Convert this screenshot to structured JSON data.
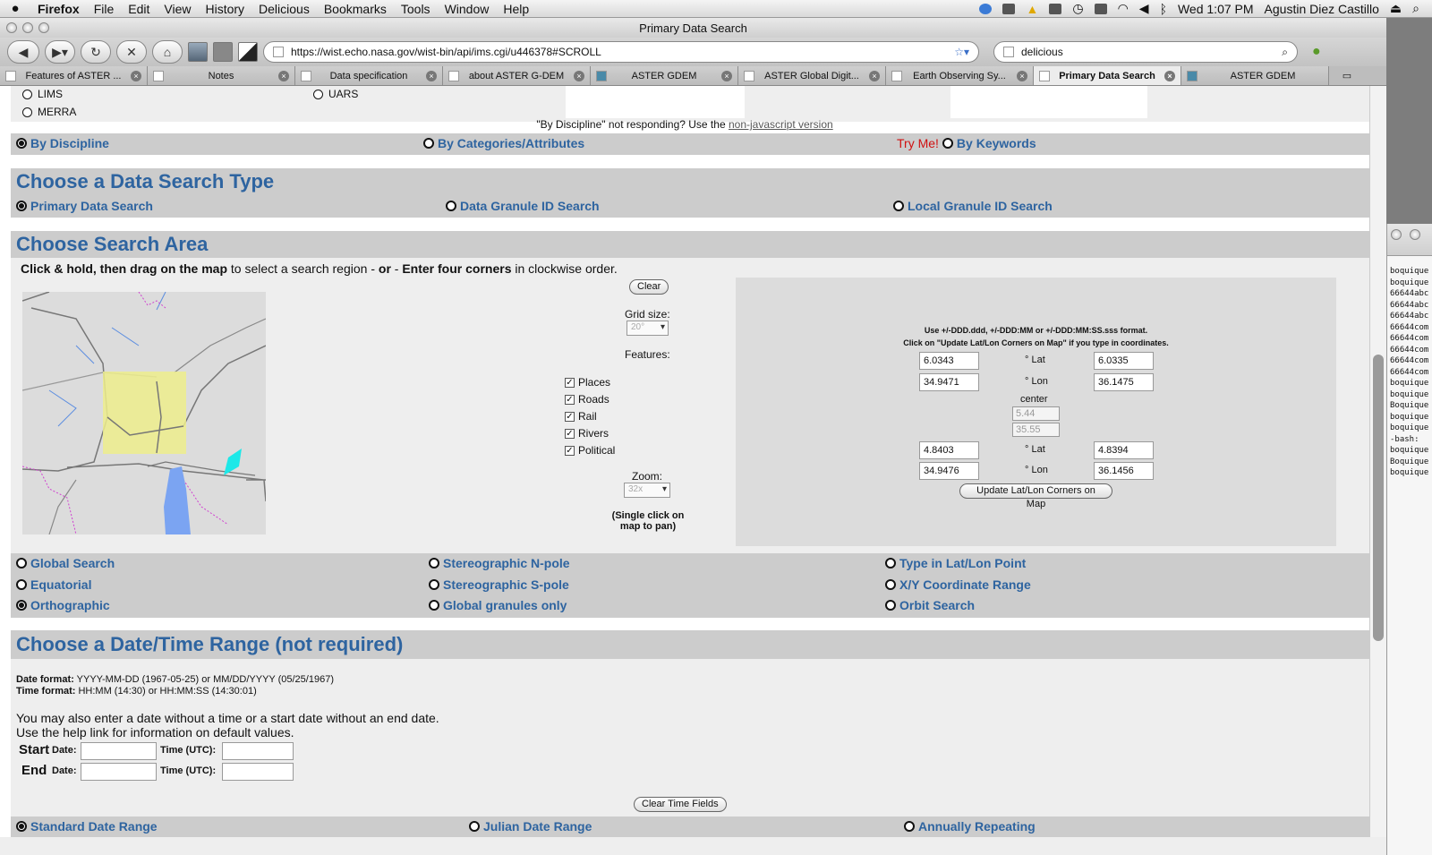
{
  "menubar": {
    "app": "Firefox",
    "menus": [
      "File",
      "Edit",
      "View",
      "History",
      "Delicious",
      "Bookmarks",
      "Tools",
      "Window",
      "Help"
    ],
    "clock": "Wed 1:07 PM",
    "user": "Agustin Diez Castillo"
  },
  "window": {
    "title": "Primary Data Search"
  },
  "nav": {
    "url": "https://wist.echo.nasa.gov/wist-bin/api/ims.cgi/u446378#SCROLL",
    "search_value": "delicious"
  },
  "tabs": [
    "Features of ASTER ...",
    "Notes",
    "Data specification",
    "about ASTER G-DEM",
    "ASTER GDEM",
    "ASTER Global Digit...",
    "Earth Observing Sy...",
    "Primary Data Search",
    "ASTER GDEM"
  ],
  "top_list": {
    "items": [
      "LIMS",
      "MERRA",
      "UARS"
    ]
  },
  "discipline_note": {
    "pre": "\"By Discipline\" not responding? Use the",
    "link": "non-javascript version"
  },
  "discipline_opts": [
    "By Discipline",
    "By Categories/Attributes",
    "Try Me!",
    "By Keywords"
  ],
  "search_type": {
    "title": "Choose a Data Search Type",
    "opts": [
      "Primary Data Search",
      "Data Granule ID Search",
      "Local Granule ID Search"
    ]
  },
  "search_area": {
    "title": "Choose Search Area",
    "instr_a": "Click & hold, then drag on the map",
    "instr_b": " to select a search region - ",
    "instr_c": "or",
    "instr_d": " - ",
    "instr_e": "Enter four corners",
    "instr_f": " in clockwise order.",
    "clear": "Clear",
    "grid_label": "Grid size:",
    "grid_value": "20°",
    "features_label": "Features:",
    "features": [
      "Places",
      "Roads",
      "Rail",
      "Rivers",
      "Political"
    ],
    "zoom_label": "Zoom:",
    "zoom_value": "32x",
    "pan_note": "(Single click on map to pan)",
    "format_note": "Use +/-DDD.ddd, +/-DDD:MM or +/-DDD:MM:SS.sss format.",
    "update_note": "Click on \"Update Lat/Lon Corners on Map\" if you type in coordinates.",
    "lat": "° Lat",
    "lon": "° Lon",
    "center": "center",
    "coords": {
      "nw_lat": "6.0343",
      "ne_lat": "6.0335",
      "nw_lon": "34.9471",
      "ne_lon": "36.1475",
      "c_lat": "5.44",
      "c_lon": "35.55",
      "sw_lat": "4.8403",
      "se_lat": "4.8394",
      "sw_lon": "34.9476",
      "se_lon": "36.1456"
    },
    "update_button": "Update Lat/Lon Corners on Map",
    "proj_opts": [
      "Global Search",
      "Stereographic N-pole",
      "Type in Lat/Lon Point",
      "Equatorial",
      "Stereographic S-pole",
      "X/Y Coordinate Range",
      "Orthographic",
      "Global granules only",
      "Orbit Search"
    ]
  },
  "date_range": {
    "title": "Choose a Date/Time Range (not required)",
    "date_fmt_label": "Date format:",
    "date_fmt": " YYYY-MM-DD (1967-05-25) or MM/DD/YYYY (05/25/1967)",
    "time_fmt_label": "Time format:",
    "time_fmt": " HH:MM (14:30) or HH:MM:SS (14:30:01)",
    "note1": "You may also enter a date without a time or a start date without an end date.",
    "note2": "Use the help link for information on default values.",
    "start": "Start",
    "end": "End",
    "date_label": "Date:",
    "time_label": "Time (UTC):",
    "clear_button": "Clear Time Fields",
    "opts": [
      "Standard Date Range",
      "Julian Date Range",
      "Annually Repeating"
    ]
  },
  "terminal": {
    "lines": [
      "boquique",
      "boquique",
      "66644abc",
      "66644abc",
      "66644abc",
      "66644com",
      "66644com",
      "66644com",
      "66644com",
      "66644com",
      "boquique",
      "boquique",
      "Boquique",
      "boquique",
      "boquique",
      "-bash: ",
      "boquique",
      "Boquique",
      "boquique"
    ]
  }
}
